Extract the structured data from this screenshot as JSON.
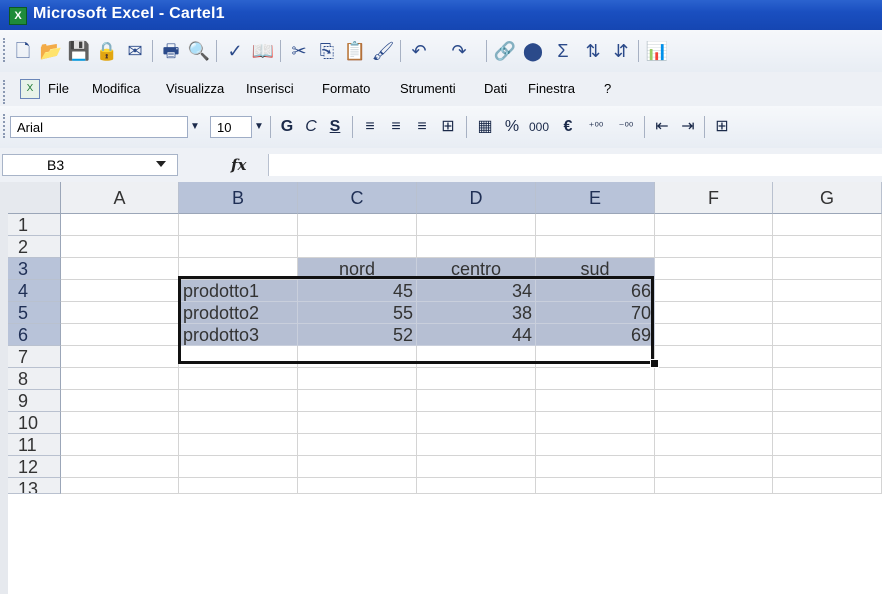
{
  "window": {
    "title": "Microsoft Excel - Cartel1",
    "app_icon": "excel-icon"
  },
  "standard_toolbar": {
    "buttons": [
      "new-icon",
      "open-icon",
      "save-icon",
      "permission-icon",
      "email-icon",
      "print-icon",
      "print-preview-icon",
      "spelling-icon",
      "research-icon",
      "cut-icon",
      "copy-icon",
      "paste-icon",
      "format-painter-icon",
      "undo-icon",
      "redo-icon",
      "hyperlink-icon",
      "chart-wizard-icon",
      "autosum-icon",
      "sort-ascending-icon",
      "sort-descending-icon",
      "chart-icon"
    ]
  },
  "menu": {
    "items": [
      "File",
      "Modifica",
      "Visualizza",
      "Inserisci",
      "Formato",
      "Strumenti",
      "Dati",
      "Finestra",
      "?"
    ]
  },
  "formatting_toolbar": {
    "font": "Arial",
    "size": "10",
    "bold": "G",
    "italic": "C",
    "underline": "S",
    "percent": "%",
    "thousands": "000",
    "currency": "€"
  },
  "formula_bar": {
    "name_box": "B3",
    "fx": "fx",
    "formula": ""
  },
  "columns": [
    "A",
    "B",
    "C",
    "D",
    "E",
    "F",
    "G"
  ],
  "rows": [
    "1",
    "2",
    "3",
    "4",
    "5",
    "6",
    "7",
    "8",
    "9",
    "10",
    "11",
    "12",
    "13"
  ],
  "table": {
    "headers": [
      "nord",
      "centro",
      "sud"
    ],
    "rows": [
      {
        "label": "prodotto1",
        "values": [
          45,
          34,
          66
        ]
      },
      {
        "label": "prodotto2",
        "values": [
          55,
          38,
          70
        ]
      },
      {
        "label": "prodotto3",
        "values": [
          52,
          44,
          69
        ]
      }
    ]
  },
  "selection": {
    "range": "B3:E6",
    "active_cell": "B3"
  }
}
